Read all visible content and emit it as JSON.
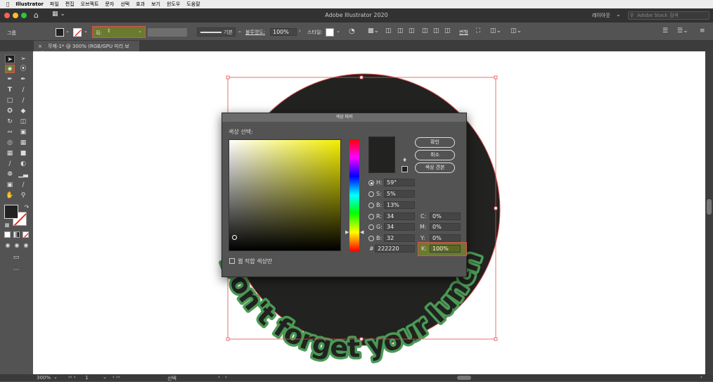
{
  "menubar": {
    "app": "Illustrator",
    "items": [
      "파일",
      "편집",
      "오브젝트",
      "문자",
      "선택",
      "효과",
      "보기",
      "윈도우",
      "도움말"
    ]
  },
  "window": {
    "title": "Adobe Illustrator 2020",
    "layout": "레이아웃",
    "stock_placeholder": "Adobe Stock 검색"
  },
  "controlbar": {
    "selection_label": "그룹",
    "stroke_label": "획:",
    "stroke_style": "기본",
    "opacity_label": "불투명도:",
    "opacity_value": "100%",
    "style_label": "스타일:",
    "transform_label": "변형"
  },
  "document_tab": {
    "title": "무제-1* @ 300% (RGB/GPU 미리 보기)"
  },
  "canvas": {
    "curved_text": "Don't forget your lunch"
  },
  "color_picker": {
    "title": "색상 피커",
    "select_label": "색상 선택:",
    "buttons": {
      "ok": "확인",
      "cancel": "취소",
      "swatches": "색상 견본"
    },
    "hsb": {
      "h_label": "H:",
      "h": "59°",
      "s_label": "S:",
      "s": "5%",
      "b_label": "B:",
      "b": "13%"
    },
    "rgb": {
      "r_label": "R:",
      "r": "34",
      "g_label": "G:",
      "g": "34",
      "b_label": "B:",
      "b": "32"
    },
    "hex_label": "#",
    "hex": "222220",
    "cmyk": {
      "c_label": "C:",
      "c": "0%",
      "m_label": "M:",
      "m": "0%",
      "y_label": "Y:",
      "y": "0%",
      "k_label": "K:",
      "k": "100%"
    },
    "web_only": "웹 적합 색상만",
    "hue_color": "#ffff00"
  },
  "status": {
    "zoom": "300%",
    "page": "1",
    "mode": "선택"
  },
  "colors": {
    "fill": "#222220",
    "highlight": "#e05050",
    "stroke_accent": "#6b7a2e"
  }
}
